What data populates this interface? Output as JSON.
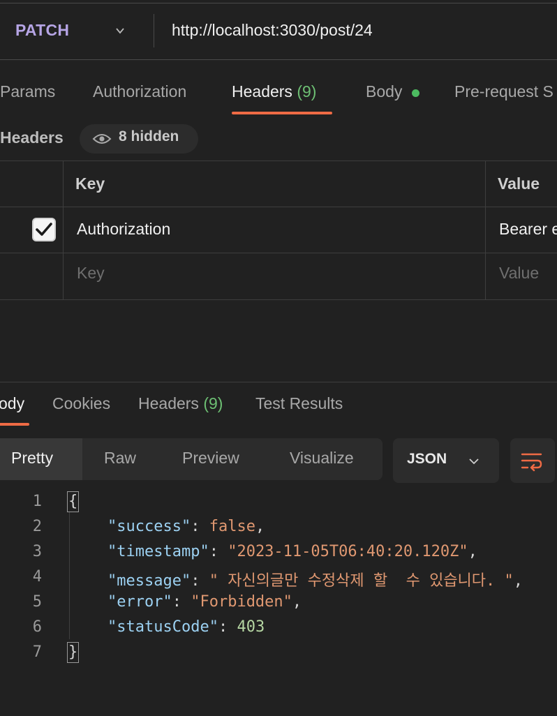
{
  "request": {
    "method": "PATCH",
    "url": "http://localhost:3030/post/24"
  },
  "request_tabs": [
    {
      "label": "Params"
    },
    {
      "label": "Authorization"
    },
    {
      "label": "Headers",
      "count": "(9)"
    },
    {
      "label": "Body"
    },
    {
      "label": "Pre-request S"
    }
  ],
  "headers_section": {
    "title": "Headers",
    "hidden_label": "8 hidden",
    "columns": {
      "key": "Key",
      "value": "Value"
    },
    "rows": [
      {
        "checked": true,
        "key": "Authorization",
        "value": "Bearer e"
      }
    ],
    "empty_row": {
      "key_placeholder": "Key",
      "value_placeholder": "Value"
    }
  },
  "response_tabs": [
    {
      "label": "ody"
    },
    {
      "label": "Cookies"
    },
    {
      "label": "Headers",
      "count": "(9)"
    },
    {
      "label": "Test Results"
    }
  ],
  "view_modes": [
    "Pretty",
    "Raw",
    "Preview",
    "Visualize"
  ],
  "format": "JSON",
  "code": {
    "line_numbers": [
      "1",
      "2",
      "3",
      "4",
      "5",
      "6",
      "7"
    ],
    "open_brace": "{",
    "close_brace": "}",
    "success_key": "\"success\"",
    "success_val": "false",
    "timestamp_key": "\"timestamp\"",
    "timestamp_val": "\"2023-11-05T06:40:20.120Z\"",
    "message_key": "\"message\"",
    "message_val": "\" 자신의글만 수정삭제 할  수 있습니다. \"",
    "error_key": "\"error\"",
    "error_val": "\"Forbidden\"",
    "status_key": "\"statusCode\"",
    "status_val": "403"
  },
  "colors": {
    "accent": "#ef6b45",
    "method": "#b6a5e5",
    "count": "#6dbf73",
    "json_key": "#9cd1f2",
    "json_string": "#e09871"
  }
}
